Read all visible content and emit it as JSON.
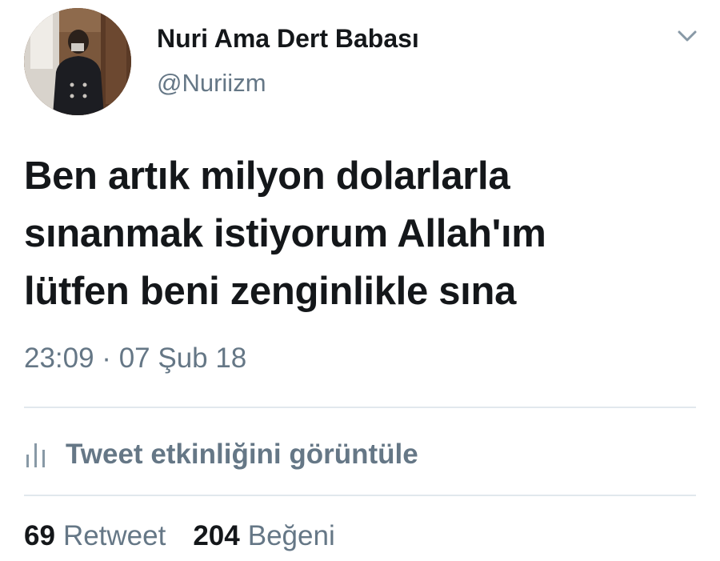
{
  "user": {
    "display_name": "Nuri Ama Dert Babası",
    "username": "@Nuriizm",
    "avatar_icon": "profile-photo"
  },
  "menu": {
    "icon": "chevron-down-icon"
  },
  "tweet": {
    "text": "Ben artık milyon dolarlarla\nsınanmak istiyorum Allah'ım\nlütfen beni zenginlikle sına",
    "timestamp": "23:09 · 07 Şub 18"
  },
  "activity": {
    "icon": "bar-chart-icon",
    "label": "Tweet etkinliğini görüntüle"
  },
  "stats": {
    "retweets": {
      "count": "69",
      "label": "Retweet"
    },
    "likes": {
      "count": "204",
      "label": "Beğeni"
    }
  },
  "colors": {
    "primary_text": "#14171a",
    "secondary_text": "#657786",
    "divider": "#e1e8ed",
    "background": "#ffffff"
  }
}
